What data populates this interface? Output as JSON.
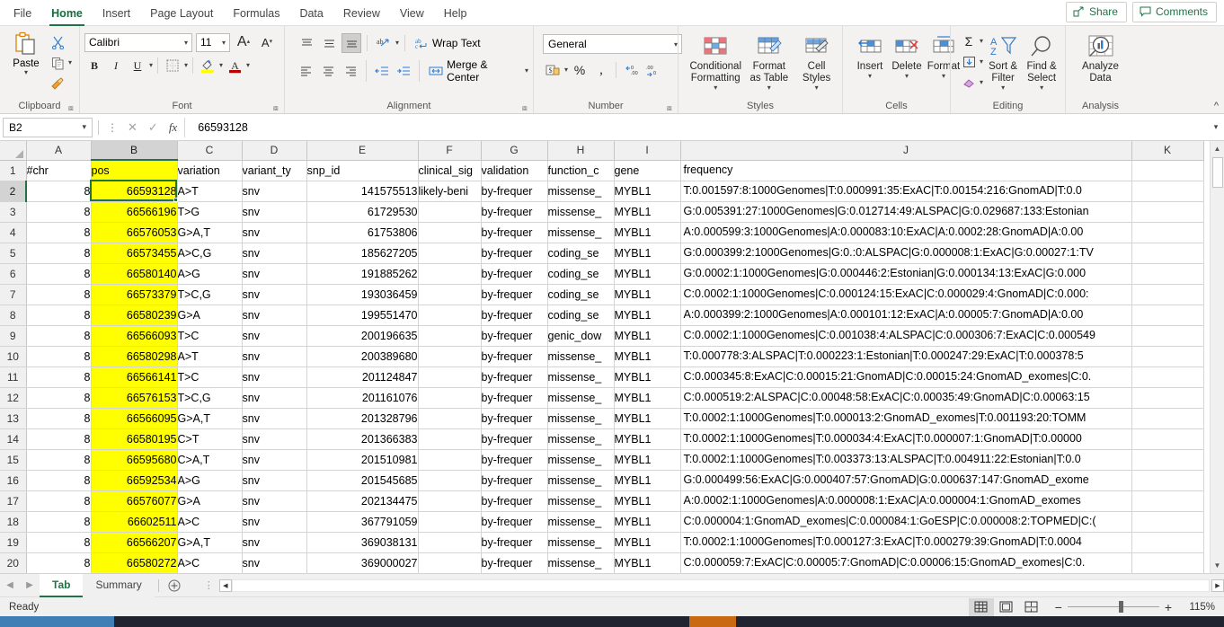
{
  "ribbon": {
    "tabs": [
      {
        "label": "File",
        "active": false
      },
      {
        "label": "Home",
        "active": true
      },
      {
        "label": "Insert",
        "active": false
      },
      {
        "label": "Page Layout",
        "active": false
      },
      {
        "label": "Formulas",
        "active": false
      },
      {
        "label": "Data",
        "active": false
      },
      {
        "label": "Review",
        "active": false
      },
      {
        "label": "View",
        "active": false
      },
      {
        "label": "Help",
        "active": false
      }
    ],
    "share_label": "Share",
    "comments_label": "Comments",
    "groups": {
      "clipboard": {
        "label": "Clipboard",
        "paste_label": "Paste",
        "cut_title": "Cut",
        "copy_title": "Copy",
        "format_painter_title": "Format Painter"
      },
      "font": {
        "label": "Font",
        "font_name": "Calibri",
        "font_size": "11",
        "grow_label": "A",
        "shrink_label": "A",
        "bold_label": "B",
        "italic_label": "I",
        "underline_label": "U"
      },
      "alignment": {
        "label": "Alignment",
        "wrap_text_label": "Wrap Text",
        "merge_center_label": "Merge & Center"
      },
      "number": {
        "label": "Number",
        "format": "General",
        "percent_label": "%",
        "comma_label": ",",
        "inc_dec_label": ".00",
        "dec_dec_label": ".00"
      },
      "styles": {
        "label": "Styles",
        "conditional_formatting_label": "Conditional Formatting",
        "format_as_table_label": "Format as Table",
        "cell_styles_label": "Cell Styles"
      },
      "cells": {
        "label": "Cells",
        "insert_label": "Insert",
        "delete_label": "Delete",
        "format_label": "Format"
      },
      "editing": {
        "label": "Editing",
        "autosum_label": "Σ",
        "sort_filter_label": "Sort & Filter",
        "find_select_label": "Find & Select"
      },
      "analysis": {
        "label": "Analysis",
        "analyze_data_label": "Analyze Data"
      }
    }
  },
  "formula_bar": {
    "name_box": "B2",
    "cancel_icon": "cancel-icon",
    "confirm_icon": "confirm-icon",
    "fx_icon": "fx-icon",
    "value": "66593128"
  },
  "grid": {
    "column_headers": [
      "A",
      "B",
      "C",
      "D",
      "E",
      "F",
      "G",
      "H",
      "I",
      "J",
      "K"
    ],
    "selected_column": "B",
    "selected_row": "2",
    "selected_cell": "B2",
    "row_numbers": [
      "1",
      "2",
      "3",
      "4",
      "5",
      "6",
      "7",
      "8",
      "9",
      "10",
      "11",
      "12",
      "13",
      "14",
      "15",
      "16",
      "17",
      "18",
      "19",
      "20"
    ],
    "highlight_color": "#ffff00",
    "header_row": [
      "#chr",
      "pos",
      "variation",
      "variant_ty",
      "snp_id",
      "clinical_sig",
      "validation",
      "function_c",
      "gene",
      "frequency",
      ""
    ],
    "rows": [
      {
        "chr": "8",
        "pos": "66593128",
        "variation": "A>T",
        "variant_type": "snv",
        "snp_id": "141575513",
        "clinical_sig": "likely-beni",
        "validation": "by-frequer",
        "function": "missense_",
        "gene": "MYBL1",
        "frequency": "T:0.001597:8:1000Genomes|T:0.000991:35:ExAC|T:0.00154:216:GnomAD|T:0.0"
      },
      {
        "chr": "8",
        "pos": "66566196",
        "variation": "T>G",
        "variant_type": "snv",
        "snp_id": "61729530",
        "clinical_sig": "",
        "validation": "by-frequer",
        "function": "missense_",
        "gene": "MYBL1",
        "frequency": "G:0.005391:27:1000Genomes|G:0.012714:49:ALSPAC|G:0.029687:133:Estonian"
      },
      {
        "chr": "8",
        "pos": "66576053",
        "variation": "G>A,T",
        "variant_type": "snv",
        "snp_id": "61753806",
        "clinical_sig": "",
        "validation": "by-frequer",
        "function": "missense_",
        "gene": "MYBL1",
        "frequency": "A:0.000599:3:1000Genomes|A:0.000083:10:ExAC|A:0.0002:28:GnomAD|A:0.00"
      },
      {
        "chr": "8",
        "pos": "66573455",
        "variation": "A>C,G",
        "variant_type": "snv",
        "snp_id": "185627205",
        "clinical_sig": "",
        "validation": "by-frequer",
        "function": "coding_se",
        "gene": "MYBL1",
        "frequency": "G:0.000399:2:1000Genomes|G:0.:0:ALSPAC|G:0.000008:1:ExAC|G:0.00027:1:TV"
      },
      {
        "chr": "8",
        "pos": "66580140",
        "variation": "A>G",
        "variant_type": "snv",
        "snp_id": "191885262",
        "clinical_sig": "",
        "validation": "by-frequer",
        "function": "coding_se",
        "gene": "MYBL1",
        "frequency": "G:0.0002:1:1000Genomes|G:0.000446:2:Estonian|G:0.000134:13:ExAC|G:0.000"
      },
      {
        "chr": "8",
        "pos": "66573379",
        "variation": "T>C,G",
        "variant_type": "snv",
        "snp_id": "193036459",
        "clinical_sig": "",
        "validation": "by-frequer",
        "function": "coding_se",
        "gene": "MYBL1",
        "frequency": "C:0.0002:1:1000Genomes|C:0.000124:15:ExAC|C:0.000029:4:GnomAD|C:0.000:"
      },
      {
        "chr": "8",
        "pos": "66580239",
        "variation": "G>A",
        "variant_type": "snv",
        "snp_id": "199551470",
        "clinical_sig": "",
        "validation": "by-frequer",
        "function": "coding_se",
        "gene": "MYBL1",
        "frequency": "A:0.000399:2:1000Genomes|A:0.000101:12:ExAC|A:0.00005:7:GnomAD|A:0.00"
      },
      {
        "chr": "8",
        "pos": "66566093",
        "variation": "T>C",
        "variant_type": "snv",
        "snp_id": "200196635",
        "clinical_sig": "",
        "validation": "by-frequer",
        "function": "genic_dow",
        "gene": "MYBL1",
        "frequency": "C:0.0002:1:1000Genomes|C:0.001038:4:ALSPAC|C:0.000306:7:ExAC|C:0.000549"
      },
      {
        "chr": "8",
        "pos": "66580298",
        "variation": "A>T",
        "variant_type": "snv",
        "snp_id": "200389680",
        "clinical_sig": "",
        "validation": "by-frequer",
        "function": "missense_",
        "gene": "MYBL1",
        "frequency": "T:0.000778:3:ALSPAC|T:0.000223:1:Estonian|T:0.000247:29:ExAC|T:0.000378:5"
      },
      {
        "chr": "8",
        "pos": "66566141",
        "variation": "T>C",
        "variant_type": "snv",
        "snp_id": "201124847",
        "clinical_sig": "",
        "validation": "by-frequer",
        "function": "missense_",
        "gene": "MYBL1",
        "frequency": "C:0.000345:8:ExAC|C:0.00015:21:GnomAD|C:0.00015:24:GnomAD_exomes|C:0."
      },
      {
        "chr": "8",
        "pos": "66576153",
        "variation": "T>C,G",
        "variant_type": "snv",
        "snp_id": "201161076",
        "clinical_sig": "",
        "validation": "by-frequer",
        "function": "missense_",
        "gene": "MYBL1",
        "frequency": "C:0.000519:2:ALSPAC|C:0.00048:58:ExAC|C:0.00035:49:GnomAD|C:0.00063:15"
      },
      {
        "chr": "8",
        "pos": "66566095",
        "variation": "G>A,T",
        "variant_type": "snv",
        "snp_id": "201328796",
        "clinical_sig": "",
        "validation": "by-frequer",
        "function": "missense_",
        "gene": "MYBL1",
        "frequency": "T:0.0002:1:1000Genomes|T:0.000013:2:GnomAD_exomes|T:0.001193:20:TOMM"
      },
      {
        "chr": "8",
        "pos": "66580195",
        "variation": "C>T",
        "variant_type": "snv",
        "snp_id": "201366383",
        "clinical_sig": "",
        "validation": "by-frequer",
        "function": "missense_",
        "gene": "MYBL1",
        "frequency": "T:0.0002:1:1000Genomes|T:0.000034:4:ExAC|T:0.000007:1:GnomAD|T:0.00000"
      },
      {
        "chr": "8",
        "pos": "66595680",
        "variation": "C>A,T",
        "variant_type": "snv",
        "snp_id": "201510981",
        "clinical_sig": "",
        "validation": "by-frequer",
        "function": "missense_",
        "gene": "MYBL1",
        "frequency": "T:0.0002:1:1000Genomes|T:0.003373:13:ALSPAC|T:0.004911:22:Estonian|T:0.0"
      },
      {
        "chr": "8",
        "pos": "66592534",
        "variation": "A>G",
        "variant_type": "snv",
        "snp_id": "201545685",
        "clinical_sig": "",
        "validation": "by-frequer",
        "function": "missense_",
        "gene": "MYBL1",
        "frequency": "G:0.000499:56:ExAC|G:0.000407:57:GnomAD|G:0.000637:147:GnomAD_exome"
      },
      {
        "chr": "8",
        "pos": "66576077",
        "variation": "G>A",
        "variant_type": "snv",
        "snp_id": "202134475",
        "clinical_sig": "",
        "validation": "by-frequer",
        "function": "missense_",
        "gene": "MYBL1",
        "frequency": "A:0.0002:1:1000Genomes|A:0.000008:1:ExAC|A:0.000004:1:GnomAD_exomes"
      },
      {
        "chr": "8",
        "pos": "66602511",
        "variation": "A>C",
        "variant_type": "snv",
        "snp_id": "367791059",
        "clinical_sig": "",
        "validation": "by-frequer",
        "function": "missense_",
        "gene": "MYBL1",
        "frequency": "C:0.000004:1:GnomAD_exomes|C:0.000084:1:GoESP|C:0.000008:2:TOPMED|C:("
      },
      {
        "chr": "8",
        "pos": "66566207",
        "variation": "G>A,T",
        "variant_type": "snv",
        "snp_id": "369038131",
        "clinical_sig": "",
        "validation": "by-frequer",
        "function": "missense_",
        "gene": "MYBL1",
        "frequency": "T:0.0002:1:1000Genomes|T:0.000127:3:ExAC|T:0.000279:39:GnomAD|T:0.0004"
      },
      {
        "chr": "8",
        "pos": "66580272",
        "variation": "A>C",
        "variant_type": "snv",
        "snp_id": "369000027",
        "clinical_sig": "",
        "validation": "by-frequer",
        "function": "missense_",
        "gene": "MYBL1",
        "frequency": "C:0.000059:7:ExAC|C:0.00005:7:GnomAD|C:0.00006:15:GnomAD_exomes|C:0."
      }
    ]
  },
  "sheet_tabs": {
    "tabs": [
      {
        "label": "Tab",
        "active": true
      },
      {
        "label": "Summary",
        "active": false
      }
    ],
    "add_sheet_icon": "plus-circle-icon",
    "prev_icon": "chevron-left-icon",
    "next_icon": "chevron-right-icon"
  },
  "status_bar": {
    "status": "Ready",
    "views": [
      "normal-view-icon",
      "page-layout-icon",
      "page-break-preview-icon"
    ],
    "zoom_out_label": "−",
    "zoom_in_label": "+",
    "zoom_level": "115%"
  }
}
